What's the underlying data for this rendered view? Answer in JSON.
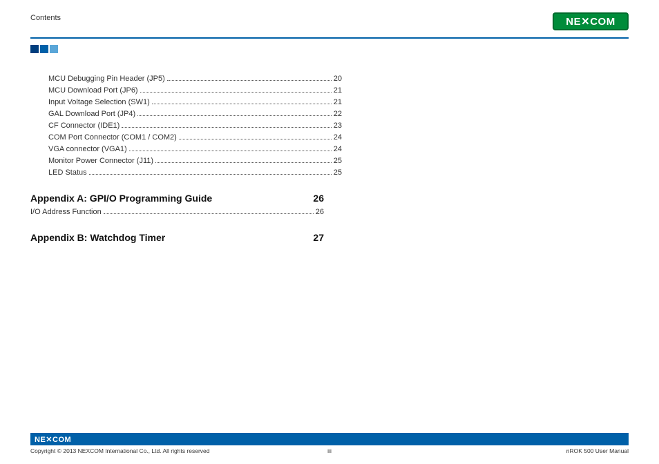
{
  "header": {
    "title": "Contents",
    "logo_text": "NE✕COM"
  },
  "toc": [
    {
      "label": "MCU Debugging Pin Header (JP5)",
      "page": "20"
    },
    {
      "label": "MCU Download Port (JP6)",
      "page": "21"
    },
    {
      "label": "Input Voltage Selection (SW1)",
      "page": "21"
    },
    {
      "label": "GAL Download Port (JP4)",
      "page": "22"
    },
    {
      "label": "CF Connector (IDE1)",
      "page": "23"
    },
    {
      "label": "COM Port Connector (COM1 / COM2)",
      "page": "24"
    },
    {
      "label": "VGA connector (VGA1)",
      "page": "24"
    },
    {
      "label": "Monitor Power Connector (J11)",
      "page": "25"
    },
    {
      "label": "LED Status",
      "page": "25"
    }
  ],
  "appendix_a": {
    "title": "Appendix A: GPI/O Programming Guide",
    "page": "26",
    "sub": {
      "label": "I/O Address Function",
      "page": "26"
    }
  },
  "appendix_b": {
    "title": "Appendix B: Watchdog Timer",
    "page": "27"
  },
  "footer": {
    "logo_text": "NE✕COM",
    "copyright": "Copyright © 2013 NEXCOM International Co., Ltd. All rights reserved",
    "page_num": "iii",
    "manual": "nROK 500 User Manual"
  }
}
